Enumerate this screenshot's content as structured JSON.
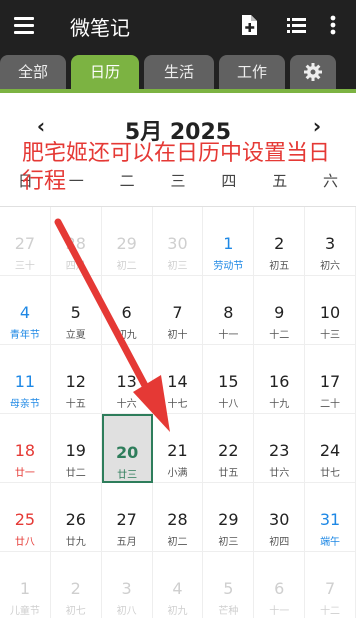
{
  "app": {
    "title": "微笔记"
  },
  "toolbar": {
    "add_icon": "add-note-icon",
    "list_icon": "list-icon",
    "more_icon": "more-vert-icon"
  },
  "tabs": [
    {
      "label": "全部"
    },
    {
      "label": "日历",
      "active": true
    },
    {
      "label": "生活"
    },
    {
      "label": "工作"
    },
    {
      "label": "",
      "icon": "gear-icon"
    }
  ],
  "calendar": {
    "month_title": "5月 2025",
    "prev_symbol": "‹",
    "next_symbol": "›",
    "weekdays": [
      "日",
      "一",
      "二",
      "三",
      "四",
      "五",
      "六"
    ],
    "cells": [
      {
        "d": "27",
        "l": "三十",
        "s": "other"
      },
      {
        "d": "28",
        "l": "四月",
        "s": "other"
      },
      {
        "d": "29",
        "l": "初二",
        "s": "other"
      },
      {
        "d": "30",
        "l": "初三",
        "s": "other"
      },
      {
        "d": "1",
        "l": "劳动节",
        "s": "blue"
      },
      {
        "d": "2",
        "l": "初五",
        "s": ""
      },
      {
        "d": "3",
        "l": "初六",
        "s": ""
      },
      {
        "d": "4",
        "l": "青年节",
        "s": "blue"
      },
      {
        "d": "5",
        "l": "立夏",
        "s": ""
      },
      {
        "d": "6",
        "l": "初九",
        "s": ""
      },
      {
        "d": "7",
        "l": "初十",
        "s": ""
      },
      {
        "d": "8",
        "l": "十一",
        "s": ""
      },
      {
        "d": "9",
        "l": "十二",
        "s": ""
      },
      {
        "d": "10",
        "l": "十三",
        "s": ""
      },
      {
        "d": "11",
        "l": "母亲节",
        "s": "blue"
      },
      {
        "d": "12",
        "l": "十五",
        "s": ""
      },
      {
        "d": "13",
        "l": "十六",
        "s": ""
      },
      {
        "d": "14",
        "l": "十七",
        "s": ""
      },
      {
        "d": "15",
        "l": "十八",
        "s": ""
      },
      {
        "d": "16",
        "l": "十九",
        "s": ""
      },
      {
        "d": "17",
        "l": "二十",
        "s": ""
      },
      {
        "d": "18",
        "l": "廿一",
        "s": "red"
      },
      {
        "d": "19",
        "l": "廿二",
        "s": ""
      },
      {
        "d": "20",
        "l": "廿三",
        "s": "today"
      },
      {
        "d": "21",
        "l": "小满",
        "s": ""
      },
      {
        "d": "22",
        "l": "廿五",
        "s": ""
      },
      {
        "d": "23",
        "l": "廿六",
        "s": ""
      },
      {
        "d": "24",
        "l": "廿七",
        "s": ""
      },
      {
        "d": "25",
        "l": "廿八",
        "s": "red"
      },
      {
        "d": "26",
        "l": "廿九",
        "s": ""
      },
      {
        "d": "27",
        "l": "五月",
        "s": ""
      },
      {
        "d": "28",
        "l": "初二",
        "s": ""
      },
      {
        "d": "29",
        "l": "初三",
        "s": ""
      },
      {
        "d": "30",
        "l": "初四",
        "s": ""
      },
      {
        "d": "31",
        "l": "端午",
        "s": "blue"
      },
      {
        "d": "1",
        "l": "儿童节",
        "s": "other"
      },
      {
        "d": "2",
        "l": "初七",
        "s": "other"
      },
      {
        "d": "3",
        "l": "初八",
        "s": "other"
      },
      {
        "d": "4",
        "l": "初九",
        "s": "other"
      },
      {
        "d": "5",
        "l": "芒种",
        "s": "other"
      },
      {
        "d": "6",
        "l": "十一",
        "s": "other"
      },
      {
        "d": "7",
        "l": "十二",
        "s": "other"
      }
    ]
  },
  "annotation": {
    "line1": "肥宅姬还可以在日历中设置当日",
    "line2": "行程",
    "color": "#e53935"
  },
  "colors": {
    "accent": "#7cb342",
    "appbar": "#212121",
    "today_border": "#2e7d5b",
    "holiday_blue": "#1e88e5",
    "weekend_red": "#e53935"
  }
}
